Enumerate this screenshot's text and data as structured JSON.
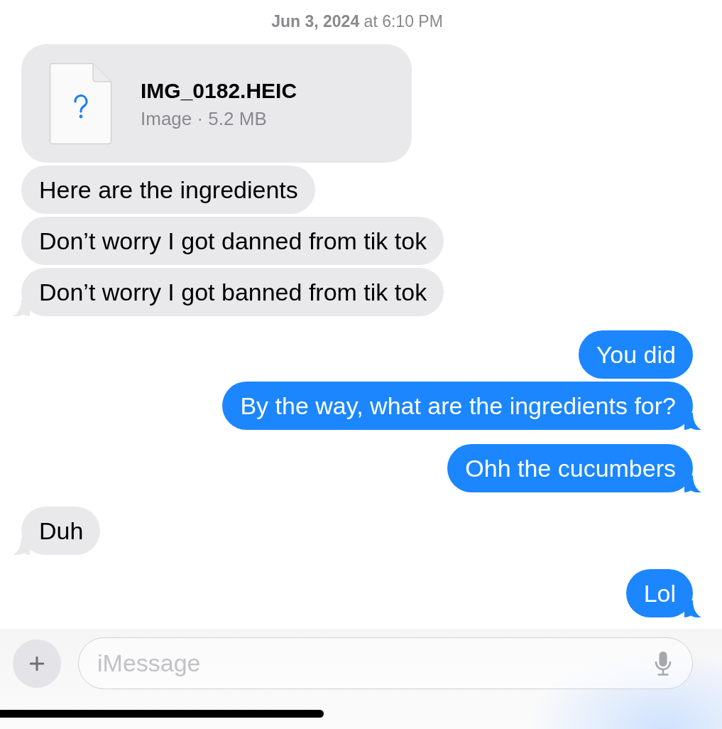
{
  "timestamp": "**Jun 3, 2024** at 6:10 PM",
  "messages": [
    {
      "kind": "file",
      "sent": false,
      "name": "IMG_0182.HEIC",
      "details": "Image · 5.2 MB",
      "tail": false
    },
    {
      "kind": "text",
      "sent": false,
      "text": "Here are the ingredients",
      "tail": false
    },
    {
      "kind": "text",
      "sent": false,
      "text": "Don’t worry I got danned from tik tok",
      "tail": false
    },
    {
      "kind": "text",
      "sent": false,
      "text": "Don’t worry I got banned from tik tok",
      "tail": true
    },
    {
      "kind": "text",
      "sent": true,
      "text": "You did",
      "tail": false
    },
    {
      "kind": "text",
      "sent": true,
      "text": "By the way, what are the ingredients for?",
      "tail": true
    },
    {
      "kind": "text",
      "sent": true,
      "text": "Ohh the cucumbers",
      "tail": true
    },
    {
      "kind": "text",
      "sent": false,
      "text": "Duh",
      "tail": true
    },
    {
      "kind": "text",
      "sent": true,
      "text": "Lol",
      "tail": true
    }
  ],
  "composer": {
    "placeholder": "iMessage"
  }
}
